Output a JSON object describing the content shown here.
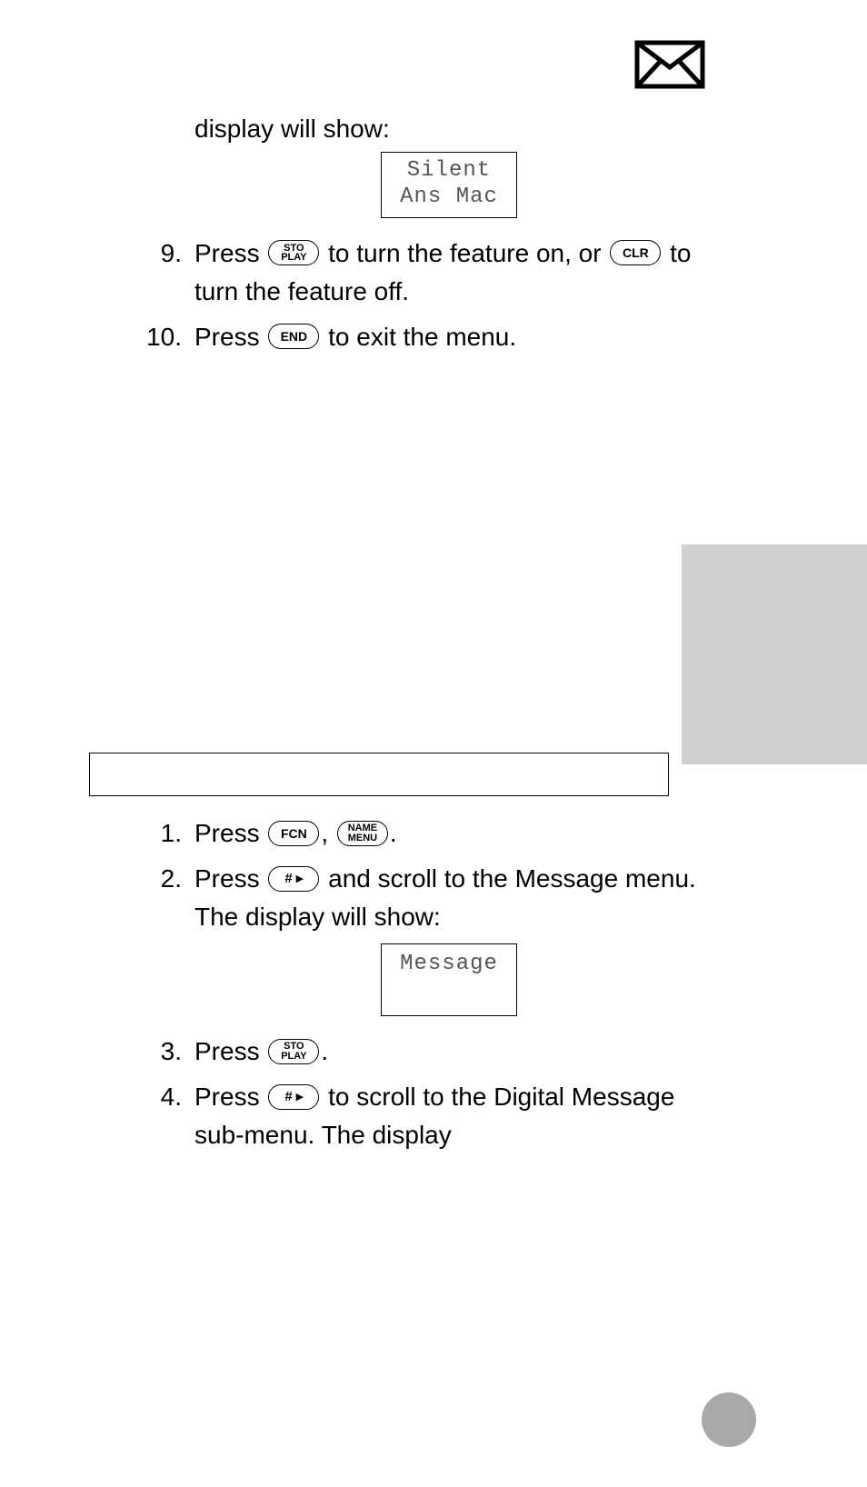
{
  "icons": {
    "mail": "mail-icon"
  },
  "top": {
    "lead": "display will show:",
    "lcd_line1": "Silent",
    "lcd_line2": "Ans Mac",
    "steps": [
      {
        "num": "9.",
        "parts": [
          {
            "t": "text",
            "v": "Press "
          },
          {
            "t": "key2",
            "v1": "STO",
            "v2": "PLAY"
          },
          {
            "t": "text",
            "v": " to turn the feature on, or "
          },
          {
            "t": "key",
            "v": "CLR"
          },
          {
            "t": "text",
            "v": " to turn the feature off."
          }
        ]
      },
      {
        "num": "10.",
        "parts": [
          {
            "t": "text",
            "v": "Press "
          },
          {
            "t": "key",
            "v": "END"
          },
          {
            "t": "text",
            "v": " to exit the menu."
          }
        ]
      }
    ]
  },
  "bottom": {
    "steps": [
      {
        "num": "1.",
        "parts": [
          {
            "t": "text",
            "v": "Press "
          },
          {
            "t": "key",
            "v": "FCN"
          },
          {
            "t": "text",
            "v": ", "
          },
          {
            "t": "key2",
            "v1": "NAME",
            "v2": "MENU"
          },
          {
            "t": "text",
            "v": "."
          }
        ]
      },
      {
        "num": "2.",
        "parts": [
          {
            "t": "text",
            "v": "Press "
          },
          {
            "t": "keyhash",
            "v": "# ▸"
          },
          {
            "t": "text",
            "v": " and scroll to the Message menu. The display will show:"
          }
        ],
        "lcd": "Message"
      },
      {
        "num": "3.",
        "parts": [
          {
            "t": "text",
            "v": "Press "
          },
          {
            "t": "key2",
            "v1": "STO",
            "v2": "PLAY"
          },
          {
            "t": "text",
            "v": "."
          }
        ]
      },
      {
        "num": "4.",
        "parts": [
          {
            "t": "text",
            "v": "Press "
          },
          {
            "t": "keyhash",
            "v": "# ▸"
          },
          {
            "t": "text",
            "v": " to scroll to the Digital Message sub-menu. The display"
          }
        ]
      }
    ]
  }
}
